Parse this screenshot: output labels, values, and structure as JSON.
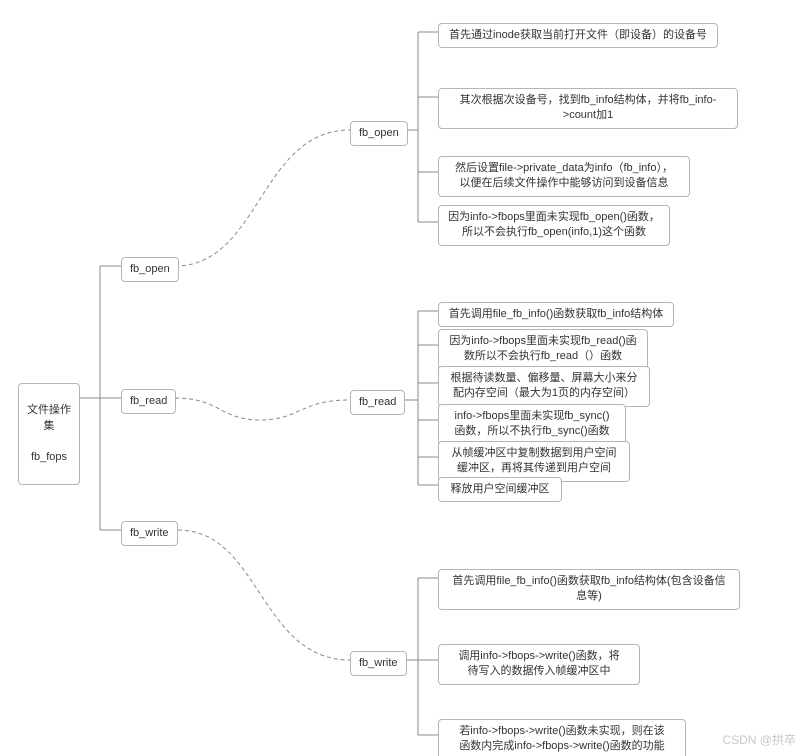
{
  "root": {
    "line1": "文件操作集",
    "line2": "fb_fops"
  },
  "mid": {
    "open": "fb_open",
    "read": "fb_read",
    "write": "fb_write"
  },
  "right": {
    "open": "fb_open",
    "read": "fb_read",
    "write": "fb_write"
  },
  "open_leaves": {
    "a": "首先通过inode获取当前打开文件（即设备）的设备号",
    "b": "其次根据次设备号，找到fb_info结构体，并将fb_info->count加1",
    "c": "然后设置file->private_data为info（fb_info），\n以便在后续文件操作中能够访问到设备信息",
    "d": "因为info->fbops里面未实现fb_open()函数，\n所以不会执行fb_open(info,1)这个函数"
  },
  "read_leaves": {
    "a": "首先调用file_fb_info()函数获取fb_info结构体",
    "b": "因为info->fbops里面未实现fb_read()函\n数所以不会执行fb_read（）函数",
    "c": "根据待读数量、偏移量、屏幕大小来分\n配内存空间（最大为1页的内存空间）",
    "d": "info->fbops里面未实现fb_sync()\n函数，所以不执行fb_sync()函数",
    "e": "从帧缓冲区中复制数据到用户空间\n缓冲区，再将其传递到用户空间",
    "f": "释放用户空间缓冲区"
  },
  "write_leaves": {
    "a": "首先调用file_fb_info()函数获取fb_info结构体(包含设备信息等)",
    "b": "调用info->fbops->write()函数，将\n待写入的数据传入帧缓冲区中",
    "c": "若info->fbops->write()函数未实现，则在该\n函数内完成info->fbops->write()函数的功能"
  },
  "watermark": "CSDN @拱卒"
}
